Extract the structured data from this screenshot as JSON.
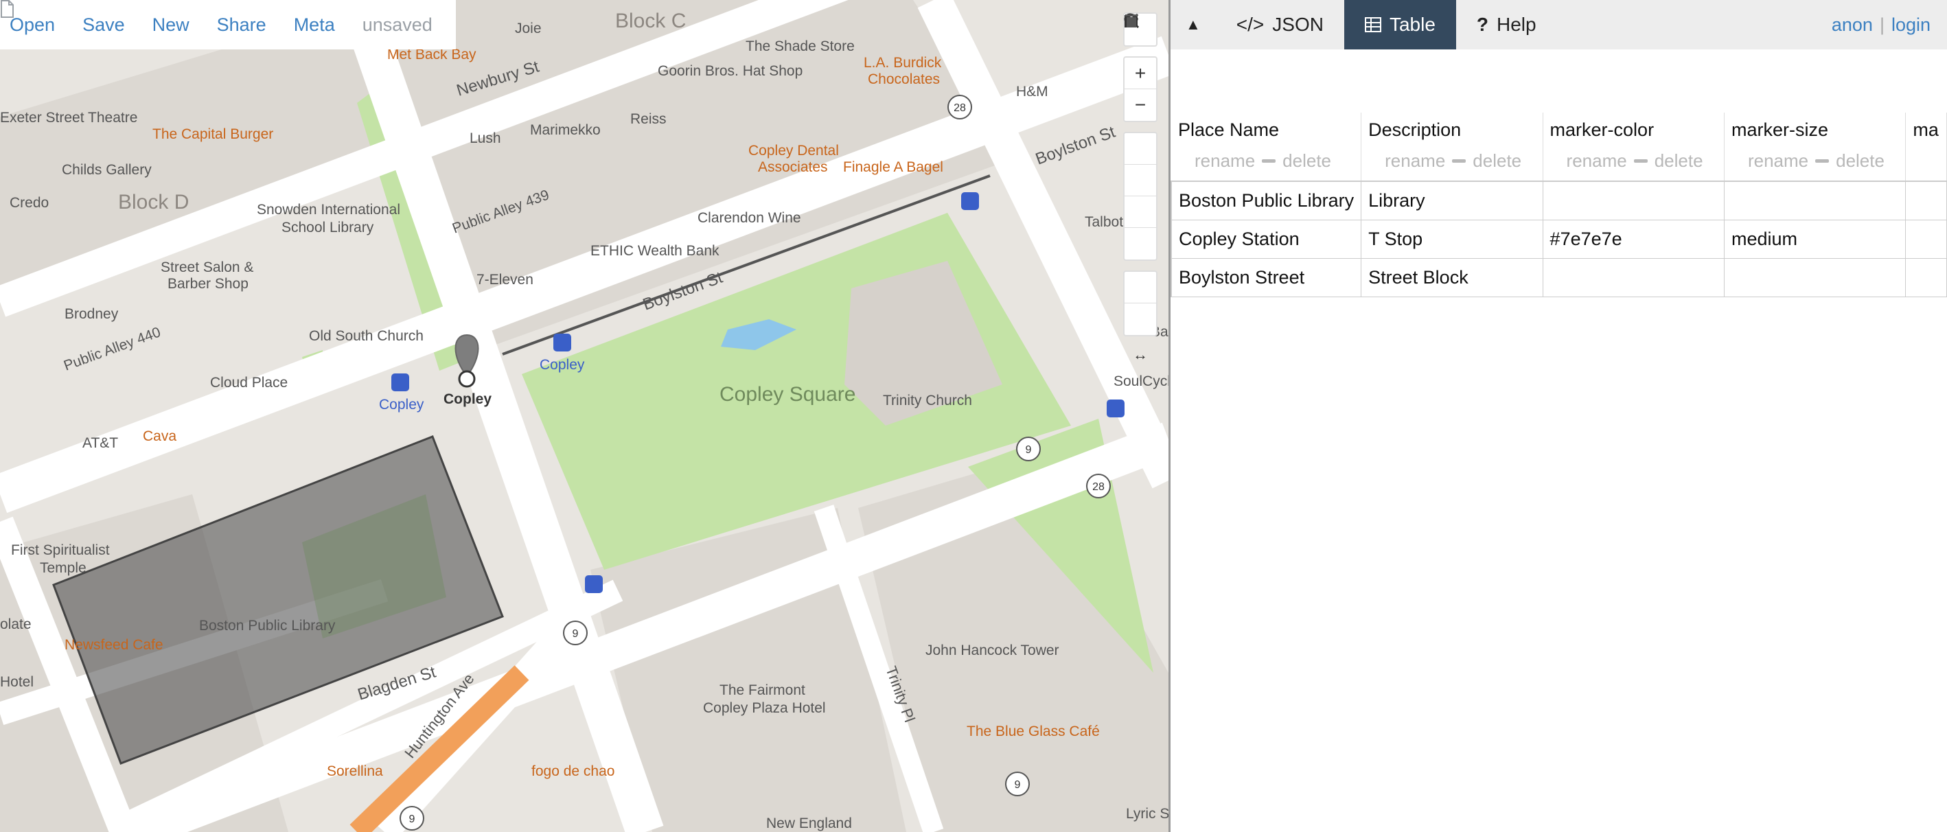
{
  "menu": {
    "open": "Open",
    "save": "Save",
    "new": "New",
    "share": "Share",
    "meta": "Meta",
    "file_status": "unsaved"
  },
  "tabs": {
    "json": "JSON",
    "table": "Table",
    "help": "Help"
  },
  "auth": {
    "anon": "anon",
    "separator": "|",
    "login": "login"
  },
  "table": {
    "columns": [
      {
        "name": "Place Name",
        "rename": "rename",
        "delete": "delete"
      },
      {
        "name": "Description",
        "rename": "rename",
        "delete": "delete"
      },
      {
        "name": "marker-color",
        "rename": "rename",
        "delete": "delete"
      },
      {
        "name": "marker-size",
        "rename": "rename",
        "delete": "delete"
      },
      {
        "name": "ma",
        "rename": "",
        "delete": ""
      }
    ],
    "rows": [
      [
        "Boston Public Library",
        "Library",
        "",
        "",
        ""
      ],
      [
        "Copley Station",
        "T Stop",
        "#7e7e7e",
        "medium",
        ""
      ],
      [
        "Boylston Street",
        "Street Block",
        "",
        "",
        ""
      ]
    ]
  },
  "map": {
    "labels": {
      "block_c": "Block C",
      "block_d": "Block D",
      "copley_square": "Copley Square",
      "trinity_church": "Trinity Church",
      "boston_public_library": "Boston Public Library",
      "fairmont_1": "The Fairmont",
      "fairmont_2": "Copley Plaza Hotel",
      "john_hancock": "John Hancock Tower",
      "blue_glass": "The Blue Glass Café",
      "newsfeed": "Newsfeed Cafe",
      "sorellina": "Sorellina",
      "fogo": "fogo de chao",
      "new_england": "New England",
      "lyric": "Lyric S",
      "newbury": "Newbury St",
      "boylston1": "Boylston St",
      "boylston2": "Boylston St",
      "blagden": "Blagden St",
      "huntington": "Huntington Ave",
      "trinity_pl": "Trinity Pl",
      "public_alley_439": "Public Alley 439",
      "public_alley_440": "Public Alley 440",
      "joie": "Joie",
      "met_back_bay": "Met Back Bay",
      "shade_store": "The Shade Store",
      "goorin": "Goorin Bros. Hat Shop",
      "burdick_1": "L.A. Burdick",
      "burdick_2": "Chocolates",
      "hm": "H&M",
      "exeter_theatre": "Exeter Street Theatre",
      "capital_burger": "The Capital Burger",
      "childs_gallery": "Childs Gallery",
      "credo": "Credo",
      "lush": "Lush",
      "marimekko": "Marimekko",
      "reiss": "Reiss",
      "copley_dental_1": "Copley Dental",
      "copley_dental_2": "Associates",
      "finagle": "Finagle A Bagel",
      "snowden_1": "Snowden International",
      "snowden_2": "School Library",
      "clarendon": "Clarendon Wine",
      "ethic": "ETHIC Wealth Bank",
      "seven_eleven": "7-Eleven",
      "street_salon_1": "Street Salon &",
      "street_salon_2": "Barber Shop",
      "brodney": "Brodney",
      "old_south": "Old South Church",
      "cloud_place": "Cloud Place",
      "copley_t": "Copley",
      "copley_blue1": "Copley",
      "copley_blue2": "Copley",
      "att": "AT&T",
      "cava": "Cava",
      "first_spiritualist_1": "First Spiritualist",
      "first_spiritualist_2": "Temple",
      "olate": "olate",
      "hotel": "Hotel",
      "talbots": "Talbot",
      "soulcycle": "SoulCycl",
      "ba": "Ba",
      "route28a": "28",
      "route28b": "28",
      "route9a": "9",
      "route9b": "9",
      "route9c": "9",
      "route9d": "9"
    }
  },
  "colors": {
    "accent": "#3c80c1",
    "active_tab": "#34495e",
    "park": "#c4e3a6",
    "poi_orange": "#c8651b",
    "transit_blue": "#3a5fc8",
    "polygon_fill": "#555555",
    "huntington": "#f2a05a"
  },
  "icons": {
    "file": "file-icon",
    "json": "code-icon",
    "table": "table-icon",
    "help": "question-icon",
    "search": "search-icon",
    "zoom_in": "plus-icon",
    "zoom_out": "minus-icon",
    "line": "line-draw-icon",
    "polygon": "polygon-draw-icon",
    "rectangle": "rectangle-draw-icon",
    "marker": "marker-draw-icon",
    "edit": "edit-icon",
    "trash": "trash-icon"
  }
}
